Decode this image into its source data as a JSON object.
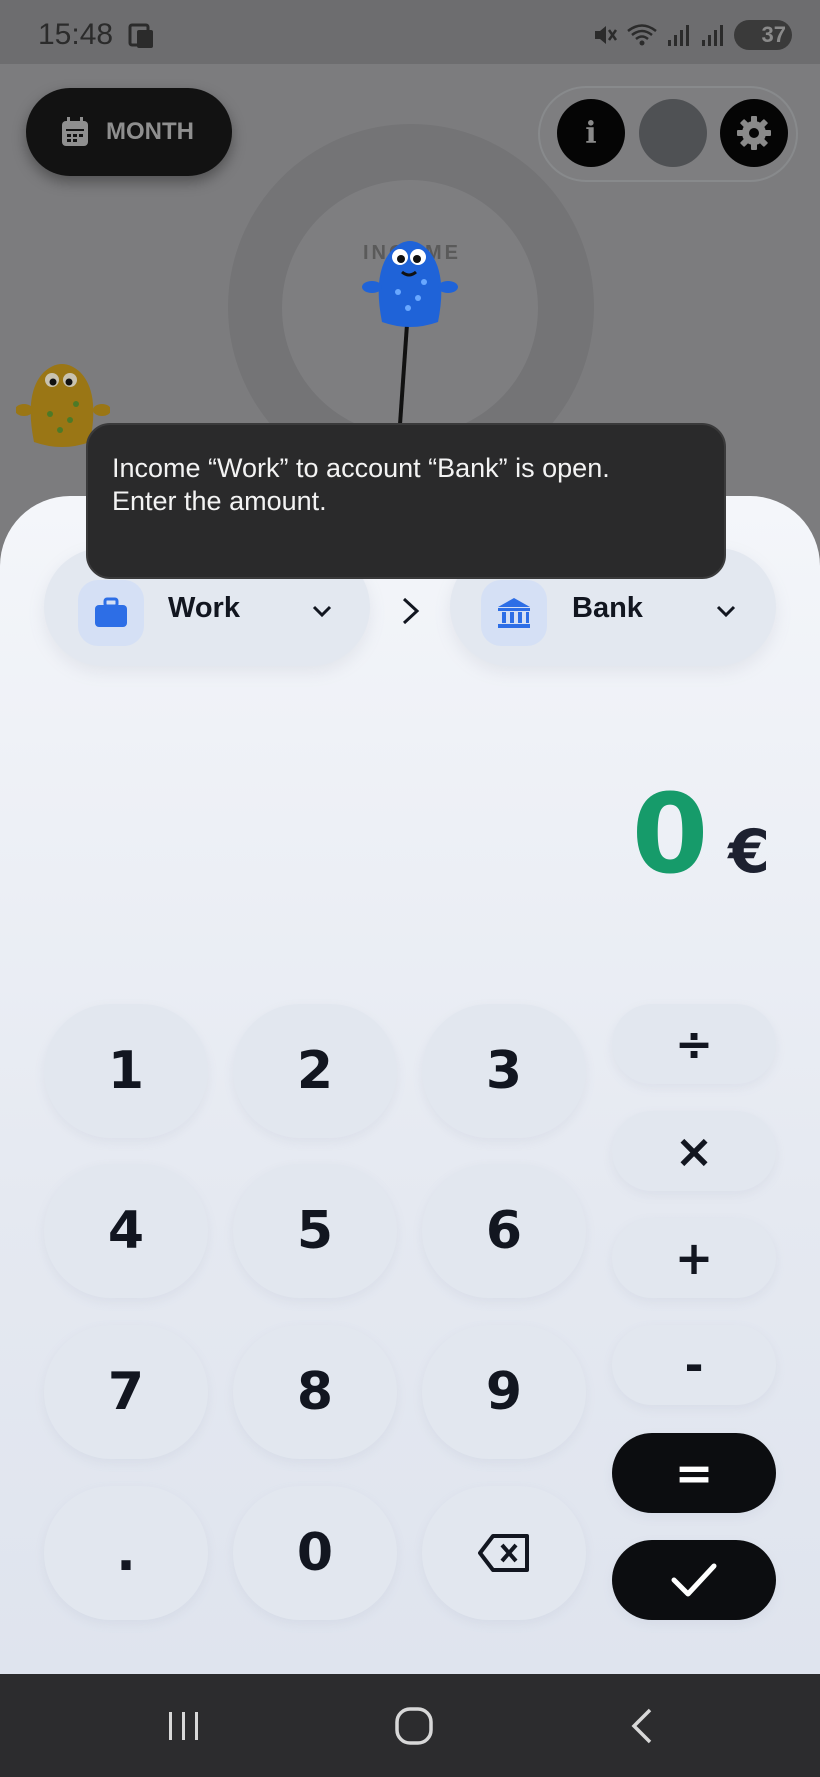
{
  "status_bar": {
    "time": "15:48",
    "battery": "37",
    "icons": [
      "phone-screen-icon",
      "mute-icon",
      "wifi-icon",
      "signal-icon",
      "signal-icon",
      "battery-icon"
    ]
  },
  "header": {
    "period_label": "MONTH",
    "info_label": "i",
    "gauge_label": "INCOME"
  },
  "toast": {
    "line1": "Income “Work” to account “Bank” is open.",
    "line2": "Enter the amount."
  },
  "transaction": {
    "from": {
      "label": "Work",
      "icon": "briefcase-icon"
    },
    "separator": "chevron-right-icon",
    "to": {
      "label": "Bank",
      "icon": "bank-icon"
    }
  },
  "amount": {
    "value": "0",
    "currency": "€"
  },
  "keypad": {
    "k1": "1",
    "k2": "2",
    "k3": "3",
    "k4": "4",
    "k5": "5",
    "k6": "6",
    "k7": "7",
    "k8": "8",
    "k9": "9",
    "dot": ".",
    "k0": "0",
    "backspace": "backspace-icon",
    "divide": "÷",
    "multiply": "×",
    "plus": "+",
    "minus": "-",
    "equals": "=",
    "confirm": "check-icon"
  },
  "nav_bar": {
    "icons": [
      "recent-apps-icon",
      "home-icon",
      "back-icon"
    ]
  },
  "colors": {
    "amount_green": "#169b6a",
    "accent_blue": "#2d6ee6",
    "dark": "#0c0d10"
  }
}
